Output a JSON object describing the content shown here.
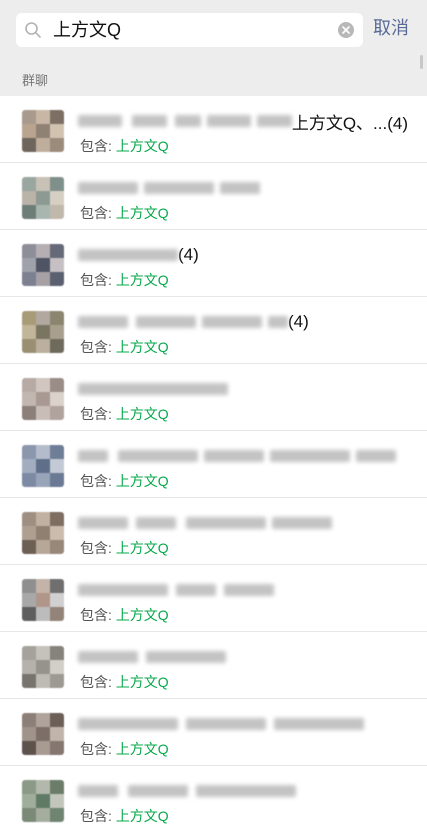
{
  "search": {
    "value": "上方文Q",
    "cancel_label": "取消"
  },
  "section": {
    "title": "群聊"
  },
  "results": [
    {
      "name_suffix": "上方文Q、...(4)",
      "contains_label": "包含: ",
      "contains_name": "上方文Q"
    },
    {
      "name_suffix": "",
      "contains_label": "包含: ",
      "contains_name": "上方文Q"
    },
    {
      "name_suffix": "(4)",
      "contains_label": "包含: ",
      "contains_name": "上方文Q"
    },
    {
      "name_suffix": "(4)",
      "contains_label": "包含: ",
      "contains_name": "上方文Q"
    },
    {
      "name_suffix": "",
      "contains_label": "包含: ",
      "contains_name": "上方文Q"
    },
    {
      "name_suffix": "",
      "contains_label": "包含: ",
      "contains_name": "上方文Q"
    },
    {
      "name_suffix": "",
      "contains_label": "包含: ",
      "contains_name": "上方文Q"
    },
    {
      "name_suffix": "",
      "contains_label": "包含: ",
      "contains_name": "上方文Q"
    },
    {
      "name_suffix": "",
      "contains_label": "包含: ",
      "contains_name": "上方文Q"
    },
    {
      "name_suffix": "",
      "contains_label": "包含: ",
      "contains_name": "上方文Q"
    },
    {
      "name_suffix": "",
      "contains_label": "包含: ",
      "contains_name": "上方文Q"
    }
  ],
  "colors": {
    "accent_green": "#07a84b",
    "cancel_blue": "#576b95",
    "header_bg": "#ededed"
  }
}
